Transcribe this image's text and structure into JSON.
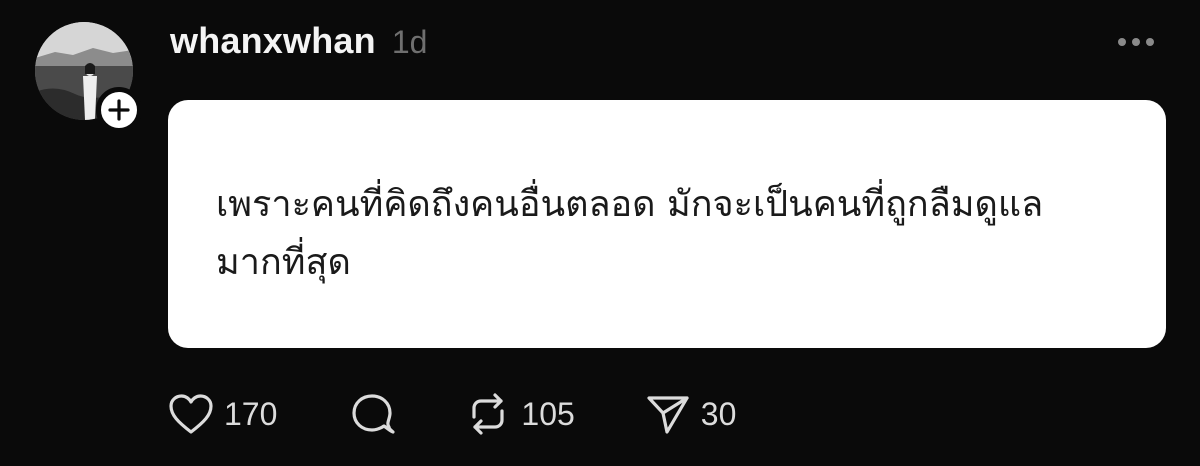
{
  "post": {
    "author": {
      "username": "whanxwhan",
      "avatar_icon": "profile-photo",
      "follow_icon": "plus-icon"
    },
    "timestamp": "1d",
    "more_icon": "more-icon",
    "content": {
      "text": "เพราะคนที่คิดถึงคนอื่นตลอด มักจะเป็นคนที่ถูกลืมดูแล มากที่สุด"
    },
    "actions": {
      "like": {
        "icon": "heart-icon",
        "count": "170"
      },
      "reply": {
        "icon": "comment-icon"
      },
      "repost": {
        "icon": "repost-icon",
        "count": "105"
      },
      "share": {
        "icon": "send-icon",
        "count": "30"
      }
    }
  },
  "colors": {
    "background": "#0a0a0a",
    "card": "#ffffff",
    "text_primary": "#f4f4f4",
    "text_muted": "#6f6f6f",
    "icon": "#dcdcdc"
  }
}
